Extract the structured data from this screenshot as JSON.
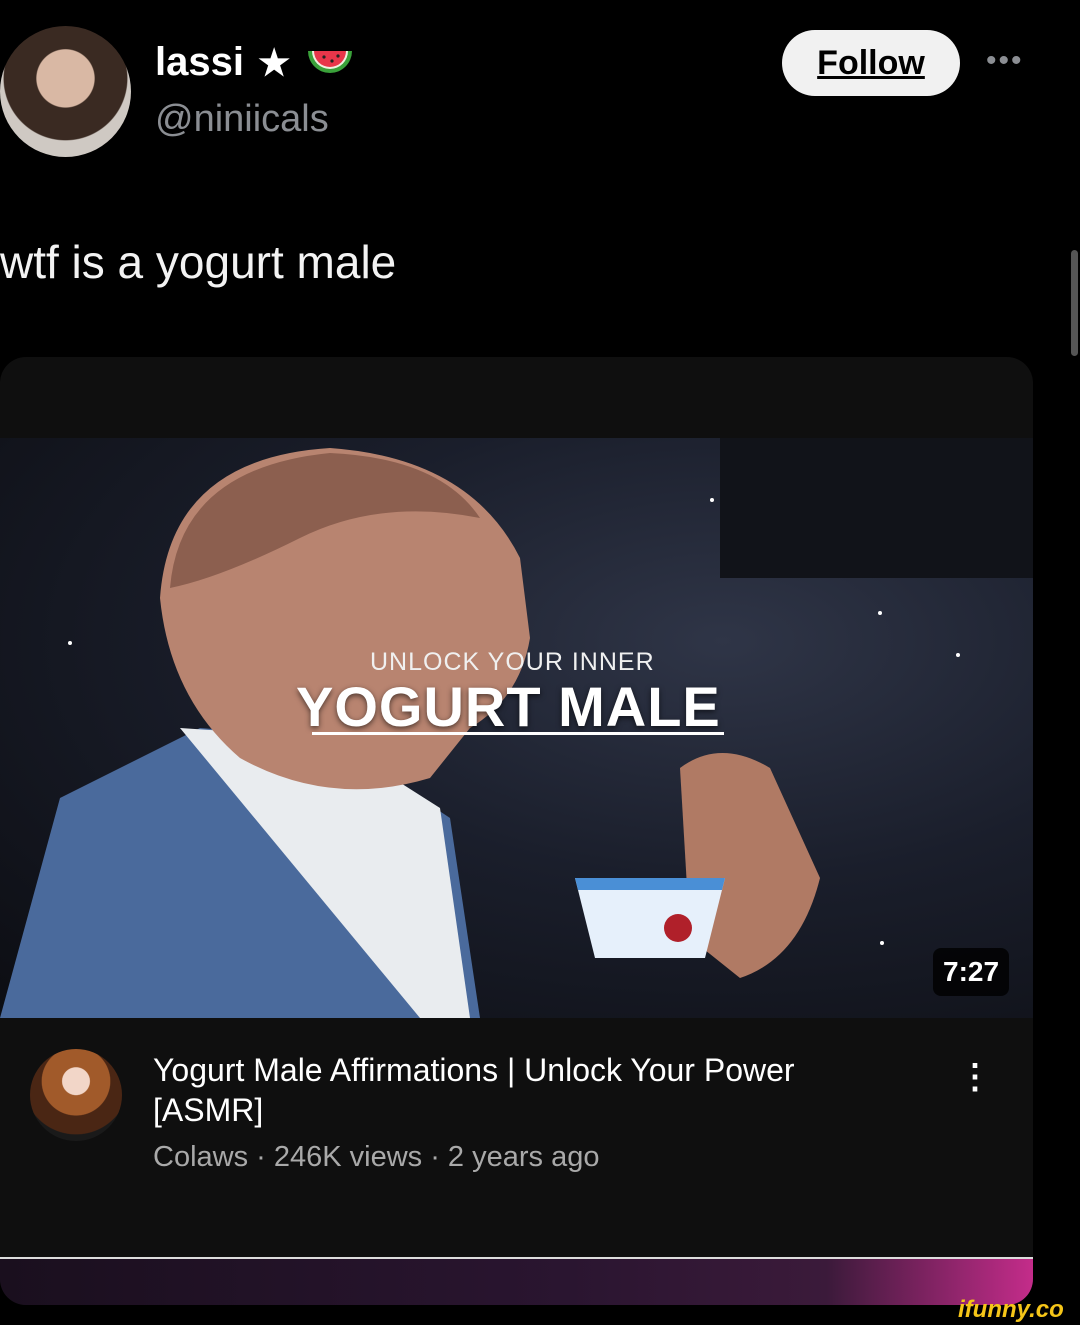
{
  "post": {
    "display_name": "lassi",
    "name_icons": [
      "star-icon",
      "watermelon-icon"
    ],
    "handle": "@niniicals",
    "follow_label": "Follow",
    "more_label": "•••",
    "text": "wtf is a yogurt male"
  },
  "video": {
    "overlay_small": "UNLOCK YOUR INNER",
    "overlay_big": "YOGURT MALE",
    "duration": "7:27",
    "title": "Yogurt Male Affirmations | Unlock Your Power [ASMR]",
    "meta": "Colaws · 246K views · 2 years ago",
    "menu_label": "⋮"
  },
  "watermark": "ifunny.co",
  "colors": {
    "background": "#000000",
    "card": "#0f0f0f",
    "follow_bg": "#f1f1f1",
    "secondary_text": "#8b8e93",
    "watermark": "#f5c518"
  }
}
